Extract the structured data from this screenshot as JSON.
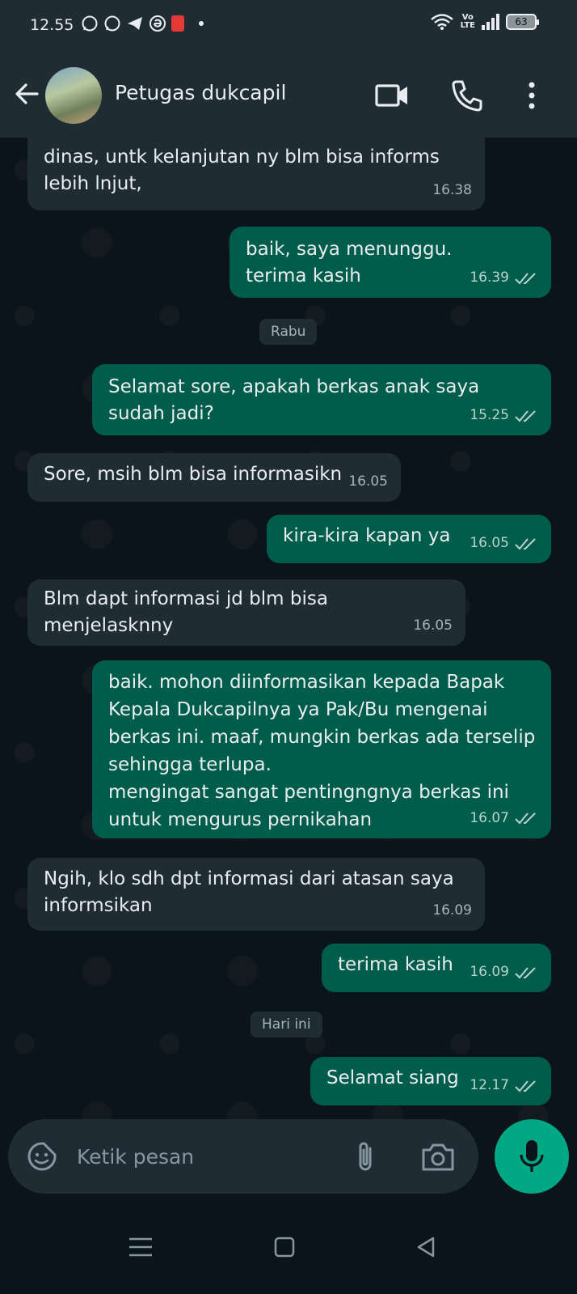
{
  "status_bar": {
    "time": "12.55",
    "network": "Vo\nLTE",
    "battery": "63"
  },
  "header": {
    "contact_name": "Petugas dukcapil"
  },
  "messages": [
    {
      "dir": "in",
      "text": "dinas, untk kelanjutan ny blm bisa informs\nlebih lnjut,",
      "time": "16.38"
    },
    {
      "dir": "out",
      "text": "baik, saya menunggu.\nterima kasih",
      "time": "16.39"
    },
    {
      "dir": "out",
      "text": "Selamat sore, apakah berkas anak saya\nsudah jadi?",
      "time": "15.25"
    },
    {
      "dir": "in",
      "text": "Sore, msih blm bisa informasikn",
      "time": "16.05"
    },
    {
      "dir": "out",
      "text": "kira-kira kapan ya",
      "time": "16.05"
    },
    {
      "dir": "in",
      "text": "Blm dapt informasi jd blm bisa menjelasknny",
      "time": "16.05"
    },
    {
      "dir": "out",
      "text": "baik. mohon diinformasikan kepada Bapak\nKepala Dukcapilnya ya Pak/Bu mengenai\nberkas ini. maaf, mungkin berkas ada terselip\nsehingga terlupa.\nmengingat sangat pentingngnya berkas ini\nuntuk mengurus pernikahan",
      "time": "16.07"
    },
    {
      "dir": "in",
      "text": "Ngih, klo sdh dpt informasi dari atasan saya\ninformsikan",
      "time": "16.09"
    },
    {
      "dir": "out",
      "text": "terima kasih",
      "time": "16.09"
    },
    {
      "dir": "out",
      "text": "Selamat siang",
      "time": "12.17"
    }
  ],
  "date_chips": [
    "Rabu",
    "Hari ini"
  ],
  "composer": {
    "placeholder": "Ketik pesan"
  },
  "colors": {
    "background": "#0b141a",
    "bar": "#1f2c33",
    "incoming_bubble": "#202c33",
    "outgoing_bubble": "#005c4b",
    "mic_button": "#00a884"
  }
}
